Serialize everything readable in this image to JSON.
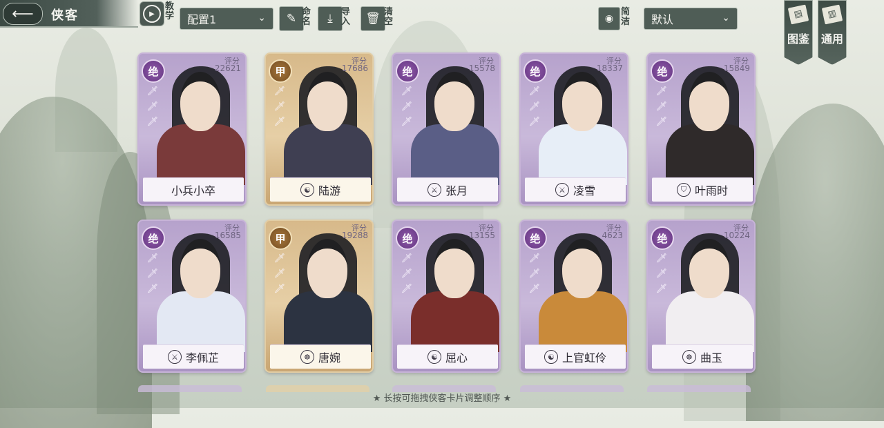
{
  "header": {
    "back_icon": "arrow-left-icon",
    "title": "侠客",
    "tutorial_label": "教学",
    "config_select": "配置1",
    "rename_label": "命名",
    "import_label": "导入",
    "clear_label": "清空",
    "simple_label": "简洁",
    "sort_select": "默认"
  },
  "side_banners": {
    "atlas_label": "图鉴",
    "general_label": "通用"
  },
  "score_label": "评分",
  "cards": [
    {
      "rank": "绝",
      "score": "22621",
      "name": "小兵小卒",
      "symbol": "",
      "tier": "purple",
      "robe": "#7a3a3a"
    },
    {
      "rank": "甲",
      "score": "17686",
      "name": "陆游",
      "symbol": "☯",
      "tier": "gold",
      "robe": "#3f3f52"
    },
    {
      "rank": "绝",
      "score": "15578",
      "name": "张月",
      "symbol": "⚔",
      "tier": "purple",
      "robe": "#5a5e86"
    },
    {
      "rank": "绝",
      "score": "18337",
      "name": "凌雪",
      "symbol": "⚔",
      "tier": "purple",
      "robe": "#e7eef7"
    },
    {
      "rank": "绝",
      "score": "15849",
      "name": "叶雨时",
      "symbol": "⛉",
      "tier": "purple",
      "robe": "#2f2a2a"
    },
    {
      "rank": "绝",
      "score": "16585",
      "name": "李佩芷",
      "symbol": "⚔",
      "tier": "purple",
      "robe": "#e3e8f3"
    },
    {
      "rank": "甲",
      "score": "19288",
      "name": "唐婉",
      "symbol": "☸",
      "tier": "gold",
      "robe": "#2c3341"
    },
    {
      "rank": "绝",
      "score": "13155",
      "name": "屈心",
      "symbol": "☯",
      "tier": "purple",
      "robe": "#7a2e2b"
    },
    {
      "rank": "绝",
      "score": "4623",
      "name": "上官虹伶",
      "symbol": "☯",
      "tier": "purple",
      "robe": "#c98a3a"
    },
    {
      "rank": "绝",
      "score": "10224",
      "name": "曲玉",
      "symbol": "☸",
      "tier": "purple",
      "robe": "#f1eef1"
    }
  ],
  "footer": {
    "hint": "★ 长按可拖拽侠客卡片调整顺序 ★"
  }
}
